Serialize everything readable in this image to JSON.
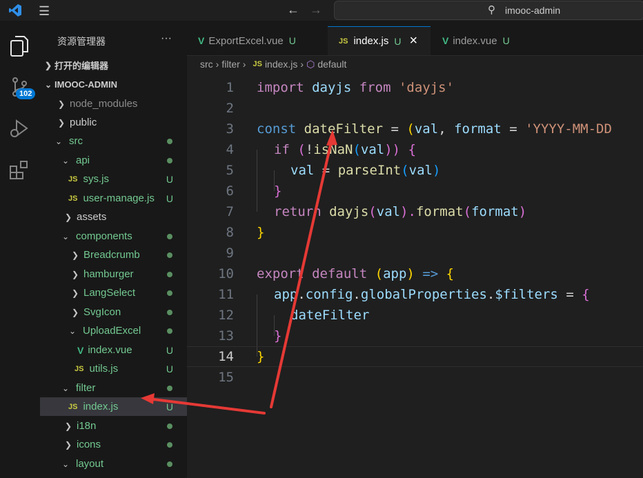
{
  "titlebar": {
    "search": "imooc-admin"
  },
  "activity": {
    "scm_badge": "102"
  },
  "explorer": {
    "title": "资源管理器",
    "more": "···",
    "open_editors": "打开的编辑器",
    "project": "IMOOC-ADMIN",
    "items": [
      {
        "label": "node_modules"
      },
      {
        "label": "public"
      },
      {
        "label": "src"
      },
      {
        "label": "api"
      },
      {
        "label": "sys.js",
        "status": "U"
      },
      {
        "label": "user-manage.js",
        "status": "U"
      },
      {
        "label": "assets"
      },
      {
        "label": "components"
      },
      {
        "label": "Breadcrumb"
      },
      {
        "label": "hamburger"
      },
      {
        "label": "LangSelect"
      },
      {
        "label": "SvgIcon"
      },
      {
        "label": "UploadExcel"
      },
      {
        "label": "index.vue",
        "status": "U"
      },
      {
        "label": "utils.js",
        "status": "U"
      },
      {
        "label": "filter"
      },
      {
        "label": "index.js",
        "status": "U"
      },
      {
        "label": "i18n"
      },
      {
        "label": "icons"
      },
      {
        "label": "layout"
      }
    ]
  },
  "tabs": [
    {
      "label": "ExportExcel.vue",
      "status": "U"
    },
    {
      "label": "index.js",
      "status": "U",
      "close": "×"
    },
    {
      "label": "index.vue",
      "status": "U"
    }
  ],
  "breadcrumb": {
    "p1": "src",
    "p2": "filter",
    "p3": "index.js",
    "p4": "default"
  },
  "code": {
    "l1": {
      "a": "import",
      "b": "dayjs",
      "c": "from",
      "d": "'dayjs'"
    },
    "l3": {
      "a": "const",
      "b": "dateFilter",
      "c": "=",
      "d": "(",
      "e": "val",
      "f": ",",
      "g": "format",
      "h": "=",
      "i": "'YYYY-MM-DD"
    },
    "l4": {
      "a": "if",
      "b": "(",
      "c": "!",
      "d": "isNaN",
      "e": "(",
      "f": "val",
      "g": "))",
      "h": "{"
    },
    "l5": {
      "a": "val",
      "b": "=",
      "c": "parseInt",
      "d": "(",
      "e": "val",
      "f": ")"
    },
    "l6": {
      "a": "}"
    },
    "l7": {
      "a": "return",
      "b": "dayjs",
      "c": "(",
      "d": "val",
      "e": ").",
      "f": "format",
      "g": "(",
      "h": "format",
      "i": ")"
    },
    "l8": {
      "a": "}"
    },
    "l10": {
      "a": "export",
      "b": "default",
      "c": "(",
      "d": "app",
      "e": ")",
      "f": "=>",
      "g": "{"
    },
    "l11": {
      "a": "app",
      "b": ".",
      "c": "config",
      "d": ".",
      "e": "globalProperties",
      "f": ".",
      "g": "$filters",
      "h": "=",
      "i": "{"
    },
    "l12": {
      "a": "dateFilter"
    },
    "l13": {
      "a": "}"
    },
    "l14": {
      "a": "}"
    }
  },
  "line_numbers": [
    "1",
    "2",
    "3",
    "4",
    "5",
    "6",
    "7",
    "8",
    "9",
    "10",
    "11",
    "12",
    "13",
    "14",
    "15"
  ]
}
